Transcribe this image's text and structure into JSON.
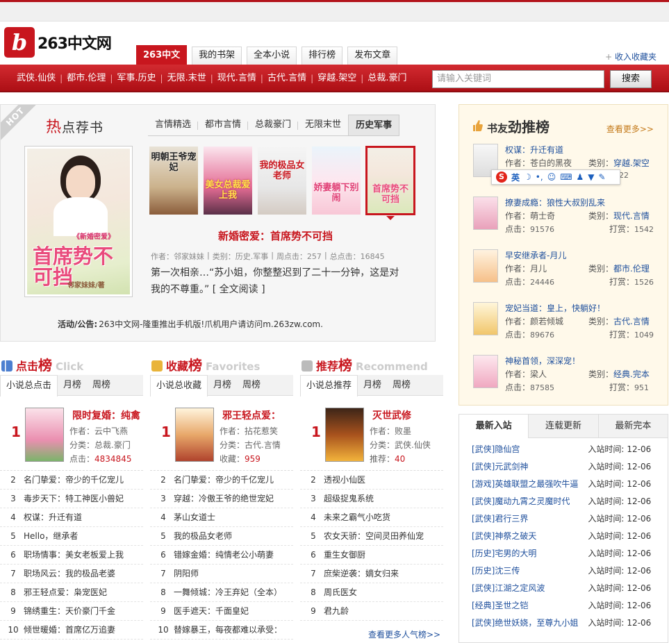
{
  "site": {
    "logo_text": "263中文网",
    "add_favorite": "收入收藏夹"
  },
  "nav": {
    "tabs": [
      "263中文",
      "我的书架",
      "全本小说",
      "排行榜",
      "发布文章"
    ]
  },
  "categories": [
    "武侠.仙侠",
    "都市.伦理",
    "军事.历史",
    "无限.末世",
    "现代.言情",
    "古代.言情",
    "穿越.架空",
    "总裁.豪门"
  ],
  "search": {
    "placeholder": "请输入关键词",
    "button": "搜索"
  },
  "hot": {
    "ribbon": "HOT",
    "title_first": "热",
    "title_rest": "点荐书",
    "tabs": [
      "言情精选",
      "都市言情",
      "总裁豪门",
      "无限末世",
      "历史军事"
    ],
    "book_title": "新婚密爱：首席势不可挡",
    "meta": {
      "author": "作者：邻家妹妹",
      "category": "类别：历史.军事",
      "weekly": "周点击：257",
      "total": "总点击：16845"
    },
    "desc": "第一次相亲…“苏小姐，你整整迟到了二十一分钟，这是对我的不尊重。” [ 全文阅读 ]",
    "notice_label": "活动/公告:",
    "notice_text": "263中文网-隆重推出手机版!爪机用户请访问m.263zw.com.",
    "cover_caption": "首席势不可挡",
    "cover_sub": "《新婚密爱》",
    "cover_author": "邻家妹妹/著",
    "thumb_titles": [
      "明朝王爷宠妃",
      "美女总裁爱上我",
      "我的极品女老师",
      "娇妻躺下别闹",
      "首席势不可挡"
    ]
  },
  "friend": {
    "title_1": "书友",
    "title_2": "劲推榜",
    "more": "查看更多>>",
    "items": [
      {
        "title": "权谋：升迁有道",
        "author_label": "作者：",
        "author": "苍白的黑夜",
        "cat_label": "类别：",
        "cat": "穿越.架空",
        "click_label": "点击：",
        "click": "",
        "reward_label": "",
        "reward": "2022"
      },
      {
        "title": "撩妻成瘾：狼性大叔别乱来",
        "author_label": "作者：",
        "author": "萌士奇",
        "cat_label": "类别：",
        "cat": "现代.言情",
        "click_label": "点击：",
        "click": "91576",
        "reward_label": "打赏：",
        "reward": "1542"
      },
      {
        "title": "早安继承者-月儿",
        "author_label": "作者：",
        "author": "月儿",
        "cat_label": "类别：",
        "cat": "都市.伦理",
        "click_label": "点击：",
        "click": "24446",
        "reward_label": "打赏：",
        "reward": "1526"
      },
      {
        "title": "宠妃当道：皇上，快躺好！",
        "author_label": "作者：",
        "author": "颜若倾城",
        "cat_label": "类别：",
        "cat": "古代.言情",
        "click_label": "点击：",
        "click": "89676",
        "reward_label": "打赏：",
        "reward": "1049"
      },
      {
        "title": "神秘首领，深深宠！",
        "author_label": "作者：",
        "author": "梁人",
        "cat_label": "类别：",
        "cat": "经典.完本",
        "click_label": "点击：",
        "click": "87585",
        "reward_label": "打赏：",
        "reward": "951"
      }
    ]
  },
  "ime": {
    "lang": "英"
  },
  "click_rank": {
    "title_1": "点击",
    "title_2": "榜",
    "en": "Click",
    "tabs": [
      "小说总点击",
      "月榜",
      "周榜"
    ],
    "top": {
      "title": "限时复婚：纯禽",
      "author": "作者：云中飞燕",
      "cat": "分类：总裁.豪门",
      "stat_label": "点击：",
      "stat": "4834845"
    },
    "items": [
      {
        "n": "2",
        "t": "名门挚爱：帝少的千亿宠儿"
      },
      {
        "n": "3",
        "t": "毒步天下：特工神医小兽妃"
      },
      {
        "n": "4",
        "t": "权谋：升迁有道"
      },
      {
        "n": "5",
        "t": "Hello，继承者"
      },
      {
        "n": "6",
        "t": "职场情事：美女老板爱上我"
      },
      {
        "n": "7",
        "t": "职场风云：我的极品老婆"
      },
      {
        "n": "8",
        "t": "邪王轻点爱：枭宠医妃"
      },
      {
        "n": "9",
        "t": "锦绣重生：天价豪门千金"
      },
      {
        "n": "10",
        "t": "倾世暖婚：首席亿万追妻"
      }
    ]
  },
  "fav_rank": {
    "title_1": "收藏",
    "title_2": "榜",
    "en": "Favorites",
    "tabs": [
      "小说总收藏",
      "月榜",
      "周榜"
    ],
    "top": {
      "title": "邪王轻点爱：",
      "author": "作者：拈花惹笑",
      "cat": "分类：古代.言情",
      "stat_label": "收藏：",
      "stat": "959"
    },
    "items": [
      {
        "n": "2",
        "t": "名门挚爱：帝少的千亿宠儿"
      },
      {
        "n": "3",
        "t": "穿越：冷傲王爷的绝世宠妃"
      },
      {
        "n": "4",
        "t": "茅山女道士"
      },
      {
        "n": "5",
        "t": "我的极品女老师"
      },
      {
        "n": "6",
        "t": "错嫁金婚：纯情老公小萌妻"
      },
      {
        "n": "7",
        "t": "阴阳师"
      },
      {
        "n": "8",
        "t": "一舞倾城：冷王弃妃（全本）"
      },
      {
        "n": "9",
        "t": "医手遮天：千面皇妃"
      },
      {
        "n": "10",
        "t": "替嫁暴王，每夜都难以承受："
      }
    ]
  },
  "rec_rank": {
    "title_1": "推荐",
    "title_2": "榜",
    "en": "Recommend",
    "tabs": [
      "小说总推荐",
      "月榜",
      "周榜"
    ],
    "top": {
      "title": "灭世武修",
      "author": "作者：败墨",
      "cat": "分类：武侠.仙侠",
      "stat_label": "推荐：",
      "stat": "40"
    },
    "items": [
      {
        "n": "2",
        "t": "透视小仙医"
      },
      {
        "n": "3",
        "t": "超级捉鬼系统"
      },
      {
        "n": "4",
        "t": "未来之霸气小吃货"
      },
      {
        "n": "5",
        "t": "农女天骄：空间灵田养仙宠"
      },
      {
        "n": "6",
        "t": "重生女御厨"
      },
      {
        "n": "7",
        "t": "庶柴逆袭：嫡女归来"
      },
      {
        "n": "8",
        "t": "周氏医女"
      },
      {
        "n": "9",
        "t": "君九龄"
      }
    ],
    "more": "查看更多人气榜>>"
  },
  "newsite": {
    "tabs": [
      "最新入站",
      "连载更新",
      "最新完本"
    ],
    "label": "入站时间:",
    "items": [
      {
        "cat": "[武侠]",
        "book": "隐仙宫",
        "date": "12-06"
      },
      {
        "cat": "[武侠]",
        "book": "元武剑神",
        "date": "12-06"
      },
      {
        "cat": "[游戏]",
        "book": "英雄联盟之最强吹牛逼",
        "date": "12-06"
      },
      {
        "cat": "[武侠]",
        "book": "魔动九霄之灵魔时代",
        "date": "12-06"
      },
      {
        "cat": "[武侠]",
        "book": "君行三界",
        "date": "12-06"
      },
      {
        "cat": "[武侠]",
        "book": "神祭之破天",
        "date": "12-06"
      },
      {
        "cat": "[历史]",
        "book": "宅男的大明",
        "date": "12-06"
      },
      {
        "cat": "[历史]",
        "book": "沈三传",
        "date": "12-06"
      },
      {
        "cat": "[武侠]",
        "book": "江湖之定风波",
        "date": "12-06"
      },
      {
        "cat": "[经典]",
        "book": "圣世之铠",
        "date": "12-06"
      },
      {
        "cat": "[武侠]",
        "book": "绝世妖娆，至尊九小姐",
        "date": "12-06"
      }
    ]
  }
}
